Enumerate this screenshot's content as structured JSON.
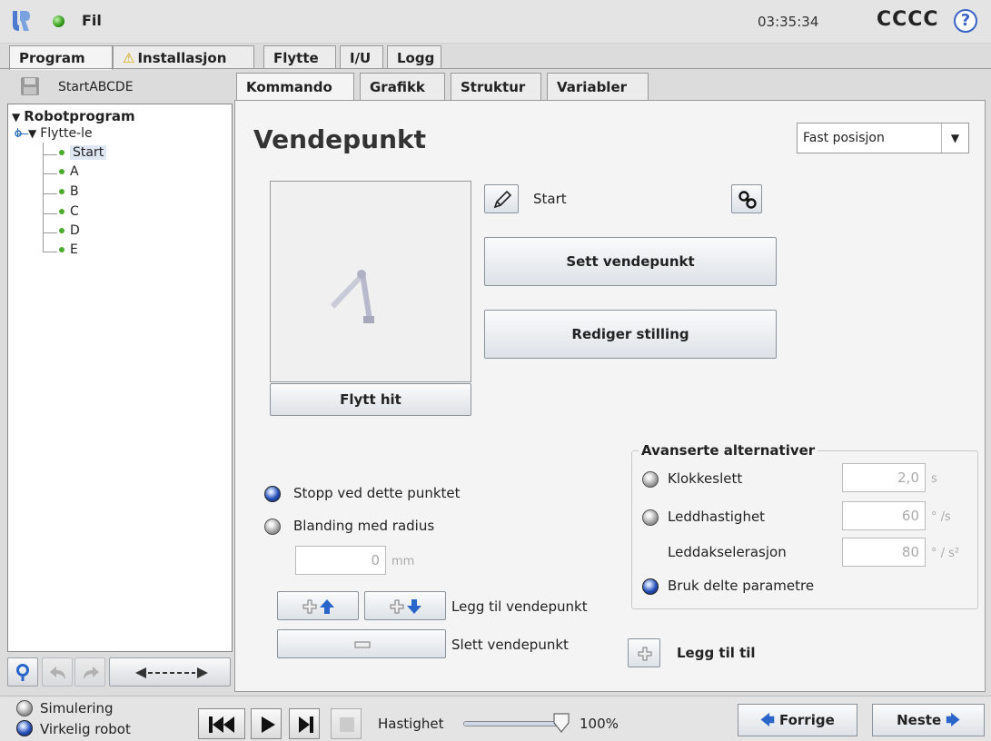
{
  "topbar": {
    "file_menu": "Fil",
    "clock": "03:35:34",
    "robot_name": "CCCC",
    "help_label": "?"
  },
  "main_tabs": [
    {
      "label": "Program",
      "active": true
    },
    {
      "label": "Installasjon",
      "warning": true
    },
    {
      "label": "Flytte"
    },
    {
      "label": "I/U"
    },
    {
      "label": "Logg"
    }
  ],
  "program": {
    "name": "StartABCDE",
    "tree": {
      "root": "Robotprogram",
      "move": "Flytte-le",
      "waypoints": [
        "Start",
        "A",
        "B",
        "C",
        "D",
        "E"
      ],
      "selected": "Start"
    }
  },
  "sub_tabs": [
    {
      "label": "Kommando",
      "active": true
    },
    {
      "label": "Grafikk"
    },
    {
      "label": "Struktur"
    },
    {
      "label": "Variabler"
    }
  ],
  "waypoint": {
    "title": "Vendepunkt",
    "position_type": "Fast posisjon",
    "name": "Start",
    "set_button": "Sett vendepunkt",
    "edit_pose_button": "Rediger stilling",
    "move_here_button": "Flytt hit",
    "stop_label": "Stopp ved dette punktet",
    "blend_label": "Blanding med radius",
    "blend_value": "0",
    "blend_unit": "mm",
    "add_waypoint_label": "Legg til vendepunkt",
    "delete_waypoint_label": "Slett vendepunkt",
    "add_until_label": "Legg til til"
  },
  "advanced": {
    "title": "Avanserte alternativer",
    "time_label": "Klokkeslett",
    "time_value": "2,0",
    "time_unit": "s",
    "joint_speed_label": "Leddhastighet",
    "joint_speed_value": "60",
    "joint_speed_unit": "° /s",
    "joint_accel_label": "Leddakselerasjon",
    "joint_accel_value": "80",
    "joint_accel_unit": "° / s²",
    "shared_label": "Bruk delte parametre"
  },
  "bottombar": {
    "simulation_label": "Simulering",
    "real_robot_label": "Virkelig robot",
    "speed_label": "Hastighet",
    "speed_value": "100%",
    "speed_fraction": 1.0,
    "prev_label": "Forrige",
    "next_label": "Neste"
  },
  "colors": {
    "accent_blue": "#2550b8",
    "status_green": "#2e9a18",
    "warning_yellow": "#d7a400"
  }
}
